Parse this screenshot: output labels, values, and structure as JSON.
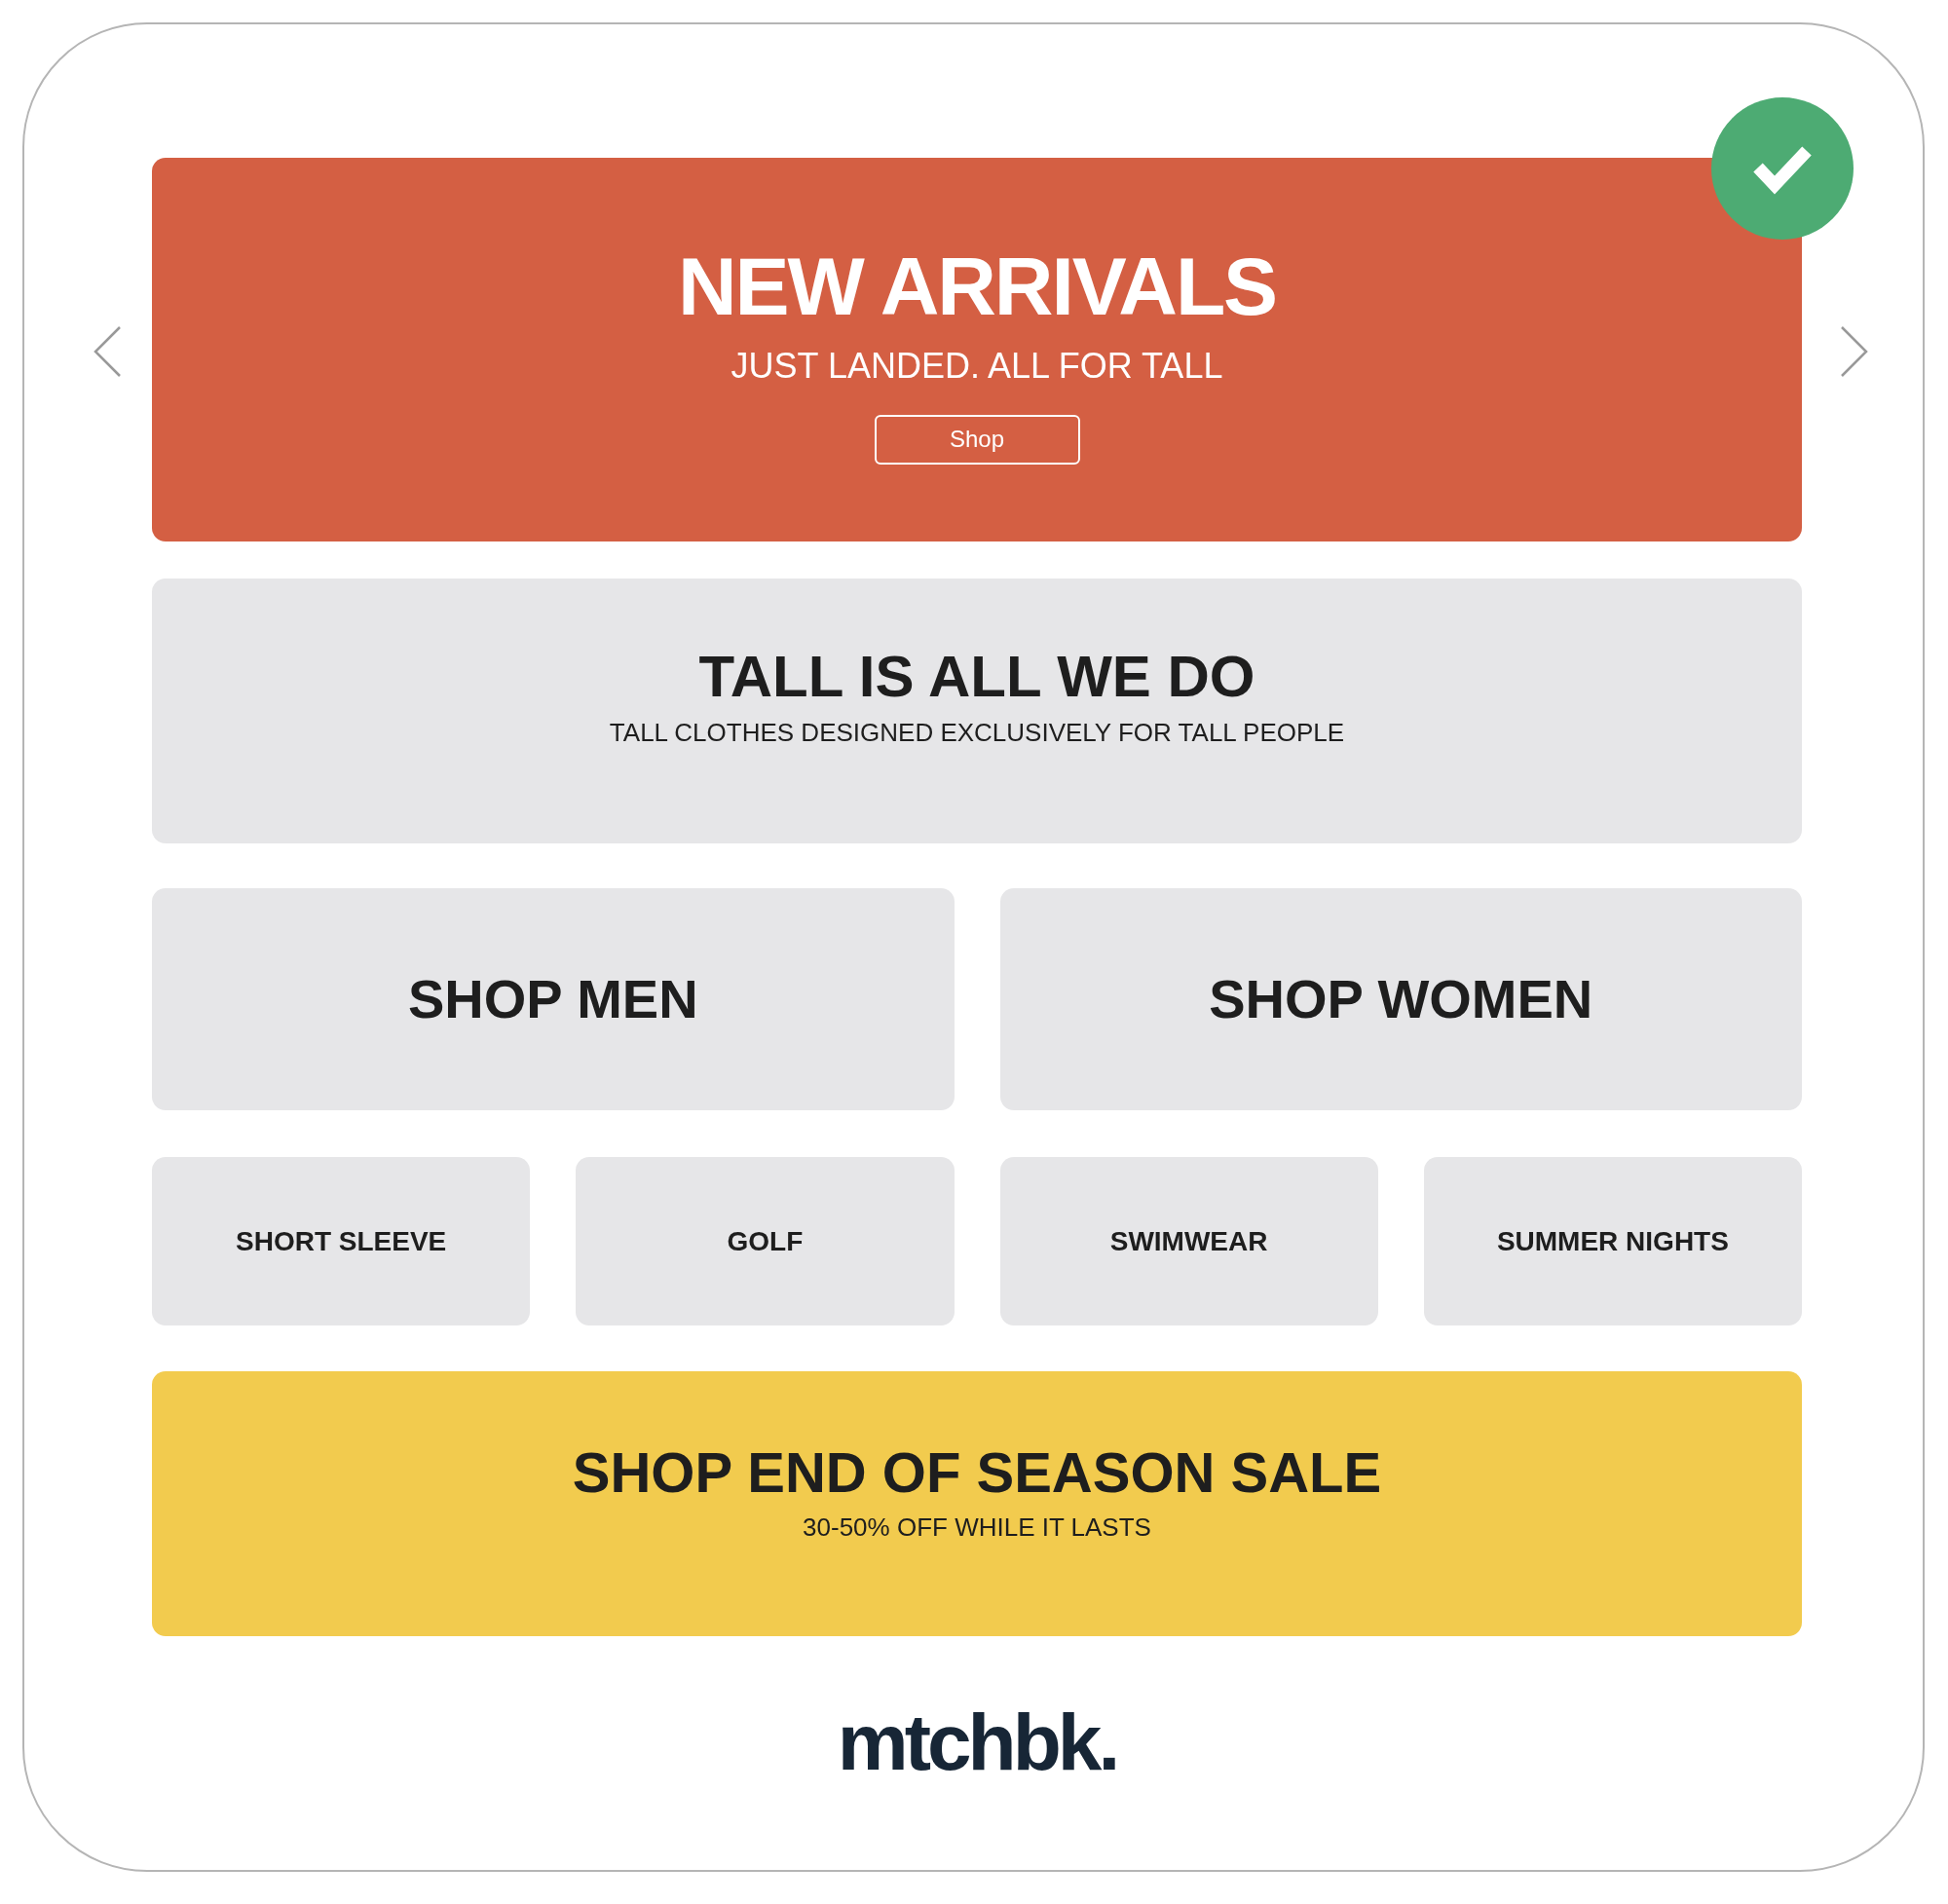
{
  "hero": {
    "title": "NEW ARRIVALS",
    "subtitle": "JUST LANDED. ALL FOR TALL",
    "button": "Shop"
  },
  "intro": {
    "title": "TALL IS ALL WE DO",
    "subtitle": "TALL CLOTHES DESIGNED EXCLUSIVELY FOR TALL PEOPLE"
  },
  "departments": [
    "SHOP MEN",
    "SHOP WOMEN"
  ],
  "categories": [
    "SHORT SLEEVE",
    "GOLF",
    "SWIMWEAR",
    "SUMMER NIGHTS"
  ],
  "sale": {
    "title": "SHOP END OF SEASON SALE",
    "subtitle": "30-50% OFF WHILE IT LASTS"
  },
  "logo": "mtchbk."
}
